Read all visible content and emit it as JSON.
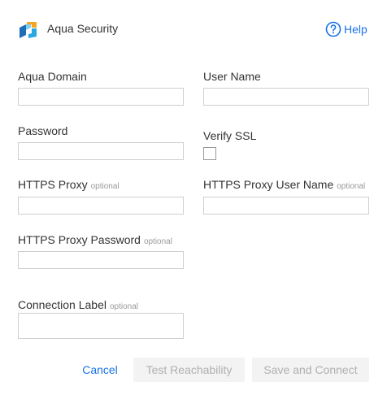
{
  "header": {
    "title": "Aqua Security",
    "logo_icon": "aqua-logo",
    "help_icon": "help-circle-icon",
    "help_label": "Help"
  },
  "form": {
    "aqua_domain": {
      "label": "Aqua Domain",
      "value": ""
    },
    "user_name": {
      "label": "User Name",
      "value": ""
    },
    "password": {
      "label": "Password",
      "value": ""
    },
    "verify_ssl": {
      "label": "Verify SSL",
      "checked": false
    },
    "https_proxy": {
      "label": "HTTPS Proxy",
      "optional": "optional",
      "value": ""
    },
    "https_proxy_user_name": {
      "label": "HTTPS Proxy User Name",
      "optional": "optional",
      "value": ""
    },
    "https_proxy_password": {
      "label": "HTTPS Proxy Password",
      "optional": "optional",
      "value": ""
    },
    "connection_label": {
      "label": "Connection Label",
      "optional": "optional",
      "value": ""
    }
  },
  "actions": {
    "cancel": "Cancel",
    "test_reachability": "Test Reachability",
    "save_and_connect": "Save and Connect"
  },
  "colors": {
    "accent": "#1a73e8",
    "disabled_bg": "#f3f3f3",
    "disabled_text": "#b0b0b0"
  }
}
